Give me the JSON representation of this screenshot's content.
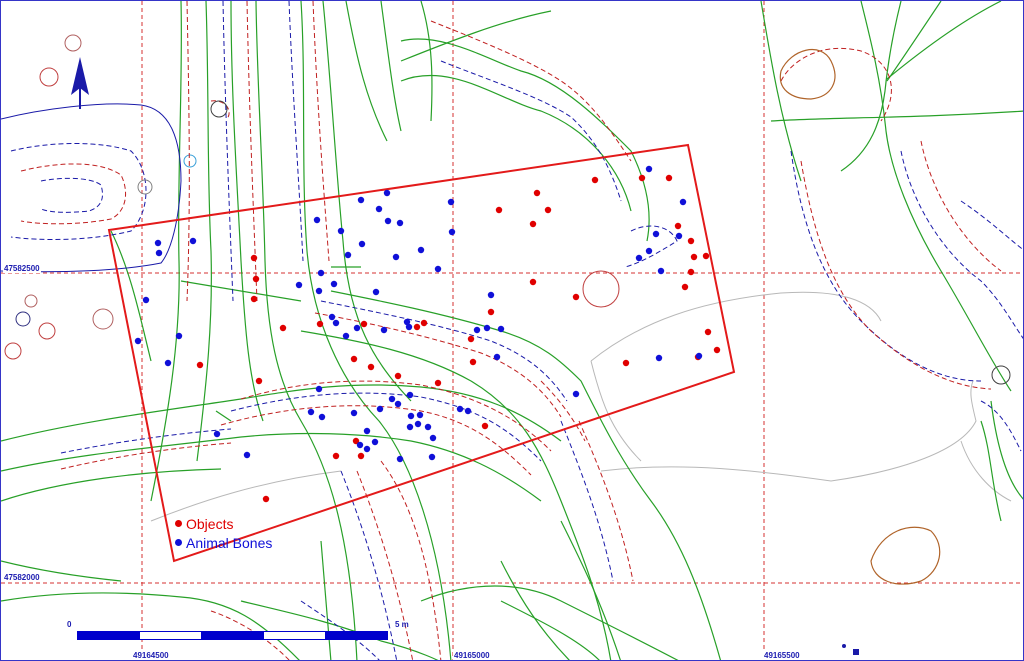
{
  "colors": {
    "objects": "#e00000",
    "animal_bones": "#1010d8",
    "survey_rectangle": "#e31a1a",
    "grid_lines": "#d43030",
    "paths": "#28a028",
    "contours_red": "#c02020",
    "contours_blue": "#1a1aa8",
    "contours_brown": "#b0642a",
    "scalebar": "#0000cc",
    "labels": "#1b1bb0"
  },
  "grid": {
    "northing_labels": [
      "47582500",
      "47582000"
    ],
    "easting_labels": [
      "49164500",
      "49165000",
      "49165500"
    ]
  },
  "north_arrow": {
    "icon": "north-arrow-icon"
  },
  "legend": {
    "items": [
      {
        "key": "objects",
        "label": "Objects"
      },
      {
        "key": "animal_bones",
        "label": "Animal Bones"
      }
    ]
  },
  "scalebar": {
    "left_label": "0",
    "right_label": "5 m",
    "segments": 5
  },
  "finds": {
    "objects": [
      [
        536,
        192
      ],
      [
        594,
        179
      ],
      [
        641,
        177
      ],
      [
        668,
        177
      ],
      [
        498,
        209
      ],
      [
        532,
        223
      ],
      [
        547,
        209
      ],
      [
        677,
        225
      ],
      [
        690,
        240
      ],
      [
        693,
        256
      ],
      [
        705,
        255
      ],
      [
        690,
        271
      ],
      [
        684,
        286
      ],
      [
        532,
        281
      ],
      [
        575,
        296
      ],
      [
        490,
        311
      ],
      [
        707,
        331
      ],
      [
        716,
        349
      ],
      [
        697,
        356
      ],
      [
        625,
        362
      ],
      [
        472,
        361
      ],
      [
        470,
        338
      ],
      [
        423,
        322
      ],
      [
        416,
        326
      ],
      [
        363,
        323
      ],
      [
        253,
        257
      ],
      [
        255,
        278
      ],
      [
        253,
        298
      ],
      [
        282,
        327
      ],
      [
        319,
        323
      ],
      [
        199,
        364
      ],
      [
        258,
        380
      ],
      [
        353,
        358
      ],
      [
        370,
        366
      ],
      [
        437,
        382
      ],
      [
        397,
        375
      ],
      [
        484,
        425
      ],
      [
        335,
        455
      ],
      [
        355,
        440
      ],
      [
        360,
        455
      ],
      [
        265,
        498
      ]
    ],
    "animal_bones": [
      [
        157,
        242
      ],
      [
        158,
        252
      ],
      [
        192,
        240
      ],
      [
        145,
        299
      ],
      [
        137,
        340
      ],
      [
        167,
        362
      ],
      [
        178,
        335
      ],
      [
        216,
        433
      ],
      [
        246,
        454
      ],
      [
        298,
        284
      ],
      [
        318,
        290
      ],
      [
        320,
        272
      ],
      [
        333,
        283
      ],
      [
        340,
        230
      ],
      [
        347,
        254
      ],
      [
        316,
        219
      ],
      [
        361,
        243
      ],
      [
        360,
        199
      ],
      [
        386,
        192
      ],
      [
        378,
        208
      ],
      [
        387,
        220
      ],
      [
        399,
        222
      ],
      [
        395,
        256
      ],
      [
        420,
        249
      ],
      [
        437,
        268
      ],
      [
        450,
        201
      ],
      [
        451,
        231
      ],
      [
        490,
        294
      ],
      [
        500,
        328
      ],
      [
        486,
        327
      ],
      [
        476,
        329
      ],
      [
        375,
        291
      ],
      [
        356,
        327
      ],
      [
        383,
        329
      ],
      [
        406,
        321
      ],
      [
        408,
        326
      ],
      [
        331,
        316
      ],
      [
        335,
        322
      ],
      [
        345,
        335
      ],
      [
        318,
        388
      ],
      [
        310,
        411
      ],
      [
        321,
        416
      ],
      [
        353,
        412
      ],
      [
        379,
        408
      ],
      [
        391,
        398
      ],
      [
        397,
        403
      ],
      [
        409,
        394
      ],
      [
        410,
        415
      ],
      [
        419,
        414
      ],
      [
        427,
        426
      ],
      [
        432,
        437
      ],
      [
        399,
        458
      ],
      [
        431,
        456
      ],
      [
        417,
        423
      ],
      [
        409,
        426
      ],
      [
        366,
        430
      ],
      [
        374,
        441
      ],
      [
        366,
        448
      ],
      [
        359,
        444
      ],
      [
        459,
        408
      ],
      [
        467,
        410
      ],
      [
        496,
        356
      ],
      [
        575,
        393
      ],
      [
        658,
        357
      ],
      [
        698,
        355
      ],
      [
        638,
        257
      ],
      [
        648,
        250
      ],
      [
        655,
        233
      ],
      [
        660,
        270
      ],
      [
        678,
        235
      ],
      [
        682,
        201
      ],
      [
        648,
        168
      ]
    ]
  }
}
